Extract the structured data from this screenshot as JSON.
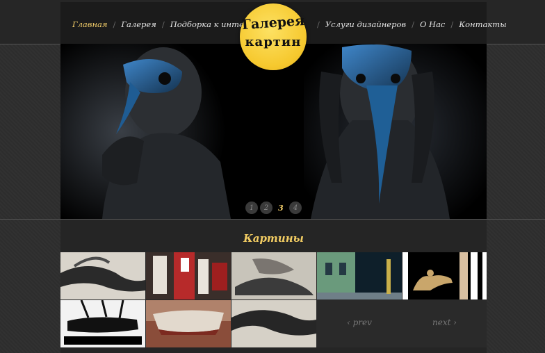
{
  "nav": {
    "left": [
      "Главная",
      "Галерея",
      "Подборка к интерьеру"
    ],
    "right": [
      "Услуги дизайнеров",
      "О Нас",
      "Контакты"
    ],
    "active": "Главная"
  },
  "logo": {
    "line1": "Галерея",
    "line2": "картин"
  },
  "slider": {
    "pages": [
      "1",
      "2",
      "3",
      "4"
    ],
    "current": "3"
  },
  "section": {
    "title": "Картины"
  },
  "gallery": {
    "thumbs": [
      "painting-1",
      "painting-2",
      "painting-3",
      "painting-4",
      "painting-5",
      "painting-6",
      "painting-7",
      "painting-8"
    ]
  },
  "pager": {
    "prev": "‹ prev",
    "next": "next ›"
  },
  "colors": {
    "accent": "#f5cf6a",
    "logo": "#f6c92f",
    "background": "#2e2e2e"
  }
}
